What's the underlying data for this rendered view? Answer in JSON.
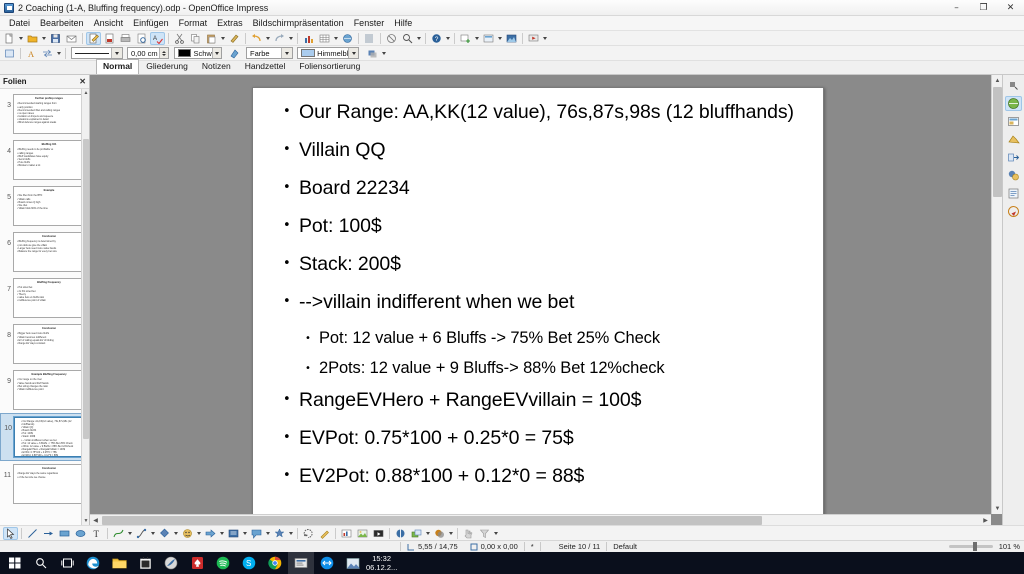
{
  "window": {
    "title": "2 Coaching (1-A, Bluffing frequency).odp - OpenOffice Impress",
    "app_icon": "impress-icon",
    "minimize": "–",
    "maximize": "❐",
    "close": "✕"
  },
  "menubar": {
    "items": [
      {
        "label": "Datei"
      },
      {
        "label": "Bearbeiten"
      },
      {
        "label": "Ansicht"
      },
      {
        "label": "Einfügen"
      },
      {
        "label": "Format"
      },
      {
        "label": "Extras"
      },
      {
        "label": "Bildschirmpräsentation"
      },
      {
        "label": "Fenster"
      },
      {
        "label": "Hilfe"
      }
    ]
  },
  "line_toolbar": {
    "line_style": "",
    "line_width": "0,00 cm",
    "line_color": "Schw",
    "area_style": "Farbe",
    "area_fill": "Himmelbl"
  },
  "tabs": {
    "items": [
      {
        "label": "Normal",
        "active": true
      },
      {
        "label": "Gliederung",
        "active": false
      },
      {
        "label": "Notizen",
        "active": false
      },
      {
        "label": "Handzettel",
        "active": false
      },
      {
        "label": "Foliensortierung",
        "active": false
      }
    ]
  },
  "slide_panel": {
    "title": "Folien",
    "close_label": "✕",
    "slides": [
      {
        "number": "3",
        "title": "Further preflop ranges",
        "lines": [
          "Recommended starting ranges from",
          "early position",
          "Recommended 3bet and calling ranges",
          "vs open raises",
          "Isolation vs limpers and squeeze",
          "situations explained in detail",
          "Blind defence ranges against steals"
        ],
        "selected": false
      },
      {
        "number": "4",
        "title": "Bluffing 101",
        "lines": [
          "Bluffing needs to be profitable vs",
          "calling ranges",
          "Bluff candidates have equity",
          "Semi bluffs",
          "Pure bluffs",
          "Blockers matter a lot"
        ],
        "selected": false
      },
      {
        "number": "5",
        "title": "Example",
        "lines": [
          "We 3bet from the BTN",
          "Villain calls",
          "Board comes Q high",
          "We cbet",
          "Villain folds 60% of the time"
        ],
        "selected": false
      },
      {
        "number": "6",
        "title": "Conclusion",
        "lines": [
          "Bluffing frequency is determined by",
          "pot odds we give the villain",
          "Larger bets need more value hands",
          "Balance the range for every bet size"
        ],
        "selected": false
      },
      {
        "number": "7",
        "title": "Bluffing Frequency",
        "lines": [
          "Pot sized bet",
          "2x Pot sized bet",
          "Theory",
          "value bets vs bluffs ratio",
          "indifference point of villain"
        ],
        "selected": false
      },
      {
        "number": "8",
        "title": "Conclusion",
        "lines": [
          "Bigger bets need more bluffs",
          "Villain becomes indifferent",
          "EV of calling equals EV of folding",
          "Range EV stays constant"
        ],
        "selected": false
      },
      {
        "number": "9",
        "title": "Example Bluffing Frequency",
        "lines": [
          "Our range on the river",
          "Value hands and bluff hands",
          "Bet sizing changes the ratio",
          "Villain indifference point"
        ],
        "selected": false
      },
      {
        "number": "10",
        "title": "",
        "lines": [
          "Our Range: AA,KK(12 value), 76s,87s,98s (12",
          "bluffhands)",
          "Villain QQ",
          "Board 22234",
          "Pot: 100$",
          "Stack: 200$",
          "-->villain indifferent when we bet",
          "Pot: 12 value + 6 Bluffs -> 75% Bet 25% Check",
          "2Pots: 12 value + 9 Bluffs-> 88% Bet 12%check",
          "RangeEVHero + RangeEVvillain = 100$",
          "EVPot: 0.75*100 + 0.25*0 = 75$",
          "EV2Pot: 0.88*100 + 0.12*0 = 88$"
        ],
        "selected": true
      },
      {
        "number": "11",
        "title": "Conclusion",
        "lines": [
          "Range EV stays the same regardless",
          "of the bet size we choose"
        ],
        "selected": false
      }
    ]
  },
  "slide": {
    "bullets": [
      {
        "level": 1,
        "text": "Our Range: AA,KK(12 value), 76s,87s,98s (12 bluffhands)",
        "bullet": "•"
      },
      {
        "level": 1,
        "text": "Villain QQ",
        "bullet": "•"
      },
      {
        "level": 1,
        "text": "Board 22234",
        "bullet": "•"
      },
      {
        "level": 1,
        "text": "Pot: 100$",
        "bullet": "•"
      },
      {
        "level": 1,
        "text": "Stack: 200$",
        "bullet": "•"
      },
      {
        "level": 1,
        "text": "-->villain indifferent when we bet",
        "bullet": "•"
      },
      {
        "level": 2,
        "text": "Pot: 12 value + 6 Bluffs -> 75% Bet 25% Check",
        "bullet": "•"
      },
      {
        "level": 2,
        "text": "2Pots: 12 value + 9 Bluffs-> 88% Bet 12%check",
        "bullet": "•"
      },
      {
        "level": 1,
        "text": "RangeEVHero + RangeEVvillain = 100$",
        "bullet": "•"
      },
      {
        "level": 1,
        "text": "EVPot: 0.75*100 + 0.25*0 = 75$",
        "bullet": "•"
      },
      {
        "level": 1,
        "text": "EV2Pot: 0.88*100 + 0.12*0 = 88$",
        "bullet": "•"
      }
    ]
  },
  "statusbar": {
    "cursor_position": "5,55 / 14,75",
    "object_size": "0,00 x 0,00",
    "modified_indicator": "*",
    "page_info": "Seite 10 / 11",
    "master_slide": "Default",
    "zoom_level": "101 %"
  },
  "taskbar": {
    "items": [
      {
        "name": "start-button"
      },
      {
        "name": "search-icon"
      },
      {
        "name": "task-view-icon"
      },
      {
        "name": "edge-icon"
      },
      {
        "name": "file-explorer-icon"
      },
      {
        "name": "store-icon"
      },
      {
        "name": "media-player-icon"
      },
      {
        "name": "poker-app-icon"
      },
      {
        "name": "spotify-icon"
      },
      {
        "name": "skype-icon"
      },
      {
        "name": "chrome-icon"
      },
      {
        "name": "impress-icon"
      },
      {
        "name": "teamviewer-icon"
      },
      {
        "name": "image-app-icon"
      }
    ],
    "clock_time": "15:32",
    "clock_date": "06.12.2..."
  }
}
